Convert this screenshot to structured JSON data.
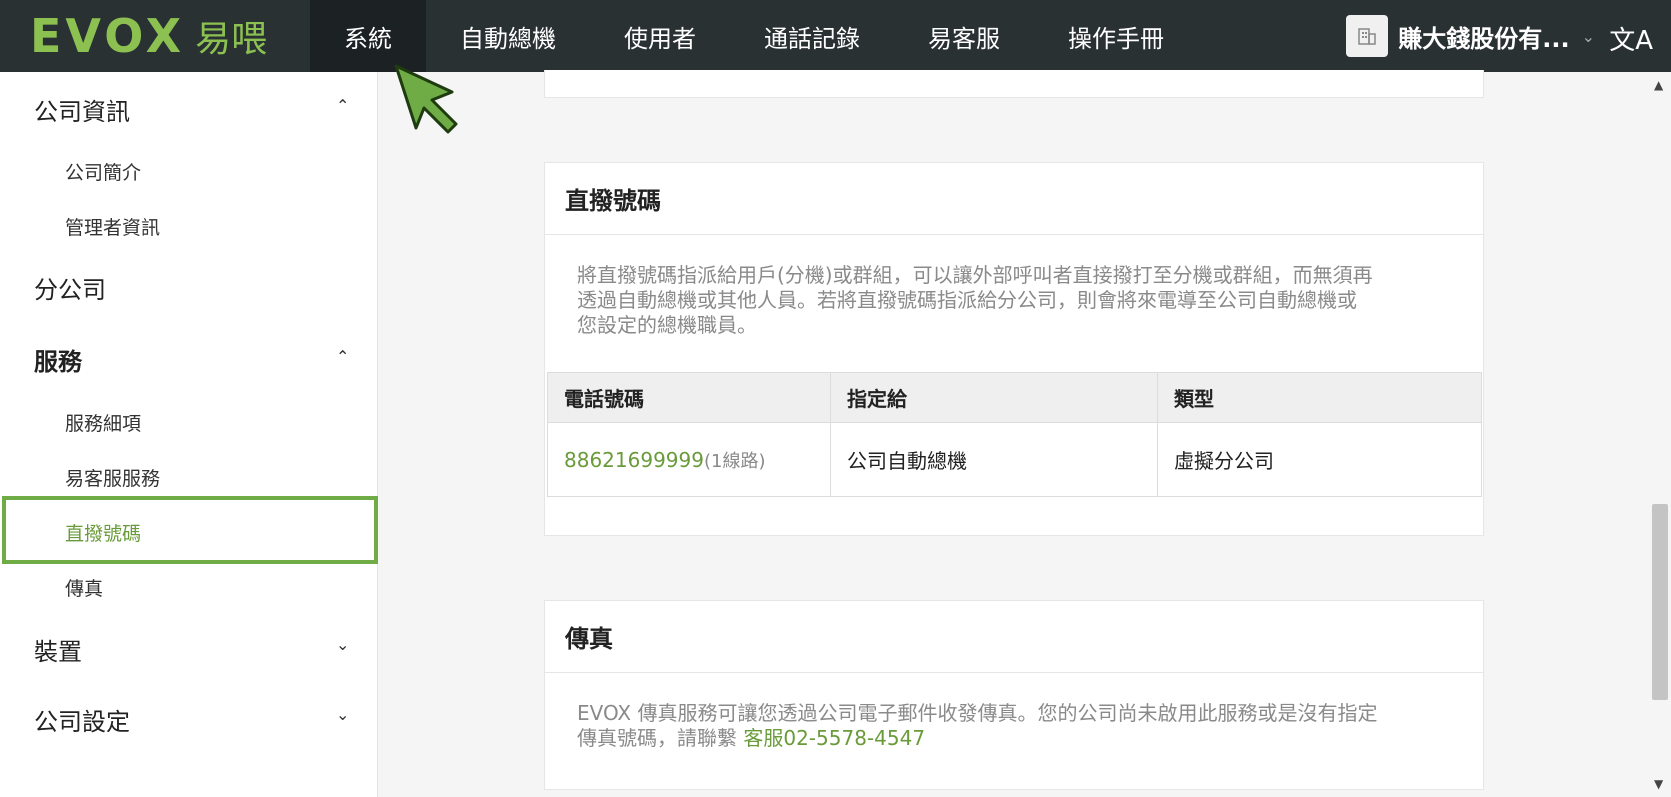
{
  "logo": {
    "text": "EVOX",
    "cn": "易喂"
  },
  "nav": {
    "items": [
      {
        "label": "系統",
        "active": true
      },
      {
        "label": "自動總機"
      },
      {
        "label": "使用者"
      },
      {
        "label": "通話記錄"
      },
      {
        "label": "易客服"
      },
      {
        "label": "操作手冊"
      }
    ],
    "company_name": "賺大錢股份有...",
    "lang_glyph": "文A"
  },
  "sidebar": {
    "company_info": "公司資訊",
    "company_profile": "公司簡介",
    "admin_info": "管理者資訊",
    "branch": "分公司",
    "services": "服務",
    "service_details": "服務細項",
    "easy_service": "易客服服務",
    "direct_number": "直撥號碼",
    "fax": "傳真",
    "devices": "裝置",
    "company_settings": "公司設定"
  },
  "direct": {
    "title": "直撥號碼",
    "desc_line1": "將直撥號碼指派給用戶(分機)或群組，可以讓外部呼叫者直接撥打至分機或群組，而無須再",
    "desc_line2": "透過自動總機或其他人員。若將直撥號碼指派給分公司，則會將來電導至公司自動總機或",
    "desc_line3": "您設定的總機職員。",
    "columns": [
      "電話號碼",
      "指定給",
      "類型"
    ],
    "row": {
      "phone": "88621699999",
      "lines": "(1線路)",
      "assigned": "公司自動總機",
      "type": "虛擬分公司"
    }
  },
  "fax": {
    "title": "傳真",
    "desc_line1": "EVOX 傳真服務可讓您透過公司電子郵件收發傳真。您的公司尚未啟用此服務或是沒有指定",
    "desc_line2_prefix": "傳真號碼，請聯繫 ",
    "desc_link": "客服02-5578-4547"
  },
  "colors": {
    "accent": "#6a9b3a",
    "topbar": "#2a3133",
    "highlight": "#6fac45"
  }
}
